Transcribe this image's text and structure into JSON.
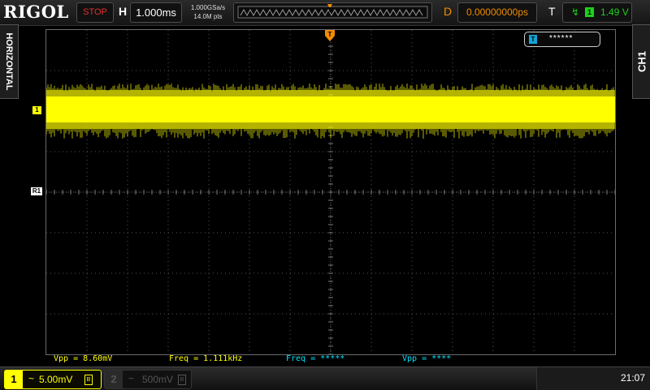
{
  "header": {
    "brand": "RIGOL",
    "run_state": "STOP",
    "horizontal_key": "H",
    "timebase": "1.000ms",
    "sample_rate": "1.000GSa/s",
    "memory_depth": "14.0M pts",
    "delay_key": "D",
    "delay": "0.00000000ps",
    "trigger_key": "T",
    "trigger_source": "1",
    "trigger_level": "1.49 V"
  },
  "side_tabs": {
    "left": "HORIZONTAL",
    "right": "CH1"
  },
  "screen": {
    "ch1_marker": "1",
    "ref_marker": "R1",
    "trigger_badge_letter": "T",
    "trigger_badge_value": "******"
  },
  "measurements": [
    {
      "label": "Vpp = ",
      "value": "8.60mV",
      "color": "#ffff00"
    },
    {
      "label": "Freq = ",
      "value": "1.111kHz",
      "color": "#ffff00"
    },
    {
      "label": "Freq = ",
      "value": "*****",
      "color": "#00e5ff"
    },
    {
      "label": "Vpp = ",
      "value": "****",
      "color": "#00e5ff"
    }
  ],
  "channels": [
    {
      "number": "1",
      "coupling": "~",
      "scale": "5.00mV",
      "bw": "B",
      "active": true,
      "color": "#ffff00"
    },
    {
      "number": "2",
      "coupling": "~",
      "scale": "500mV",
      "bw": "B",
      "active": false,
      "color": "#555555"
    }
  ],
  "status": {
    "clock": "21:07"
  },
  "colors": {
    "ch1": "#ffff00",
    "ch2_inactive": "#555555",
    "trigger": "#f28c00",
    "stop": "#e23030",
    "trigger_source": "#1cd11c",
    "math_measure": "#00e5ff"
  }
}
